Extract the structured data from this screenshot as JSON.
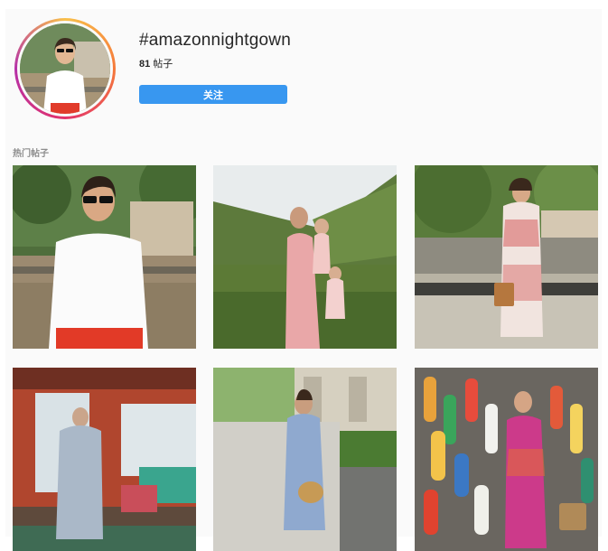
{
  "header": {
    "hashtag": "#amazonnightgown",
    "posts_number": "81",
    "posts_suffix": " 帖子",
    "follow_label": "关注"
  },
  "section": {
    "title": "热门帖子"
  },
  "posts": [
    {
      "id": "post-1",
      "alt": "woman in white t-shirt"
    },
    {
      "id": "post-2",
      "alt": "mother and daughter in vineyard"
    },
    {
      "id": "post-3",
      "alt": "woman in floral caftan with basket"
    },
    {
      "id": "post-4",
      "alt": "woman in blue robe in sunroom"
    },
    {
      "id": "post-5",
      "alt": "woman in blue dress on sidewalk"
    },
    {
      "id": "post-6",
      "alt": "woman in pink dress with buoys"
    }
  ],
  "colors": {
    "accent": "#3897f0",
    "ring_start": "#f9c04a",
    "ring_end": "#b530a8"
  }
}
